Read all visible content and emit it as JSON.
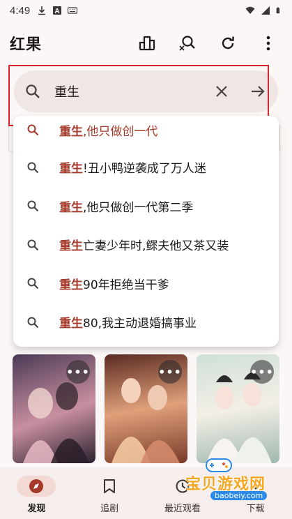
{
  "status_bar": {
    "time": "4:49"
  },
  "app": {
    "title": "红果",
    "actions": [
      "ranking-icon",
      "search-icon",
      "refresh-icon",
      "more-vert-icon"
    ]
  },
  "search": {
    "value": "重生",
    "placeholder": ""
  },
  "suggestions": [
    {
      "prefix": "重生",
      "rest": ",他只做创一代"
    },
    {
      "prefix": "重生",
      "rest": "!丑小鸭逆袭成了万人迷"
    },
    {
      "prefix": "重生",
      "rest": ",他只做创一代第二季"
    },
    {
      "prefix": "重生",
      "rest": "亡妻少年时,鳏夫他又茶又装"
    },
    {
      "prefix": "重生",
      "rest": "90年拒绝当干爹"
    },
    {
      "prefix": "重生",
      "rest": "80,我主动退婚搞事业"
    }
  ],
  "cards": [
    {
      "more": "•••",
      "colors": [
        "#4a3a55",
        "#c98fa0",
        "#2a2230"
      ]
    },
    {
      "more": "•••",
      "colors": [
        "#5a2a22",
        "#e0a07a",
        "#7a3a2a"
      ]
    },
    {
      "more": "•••",
      "colors": [
        "#cfe0d8",
        "#f3efe6",
        "#9fb8ae"
      ]
    }
  ],
  "bottom_nav": [
    {
      "label": "发现",
      "icon": "compass-icon",
      "active": true
    },
    {
      "label": "追剧",
      "icon": "bookmark-icon",
      "active": false
    },
    {
      "label": "最近观看",
      "icon": "history-icon",
      "active": false
    },
    {
      "label": "下载",
      "icon": "download-icon",
      "active": false
    }
  ],
  "watermark": {
    "text": "宝贝游戏网",
    "url": "baobeiy.com"
  },
  "colors": {
    "accent": "#a63a2a",
    "highlight_box": "#d8262e",
    "search_bg": "#f0e6e3"
  }
}
